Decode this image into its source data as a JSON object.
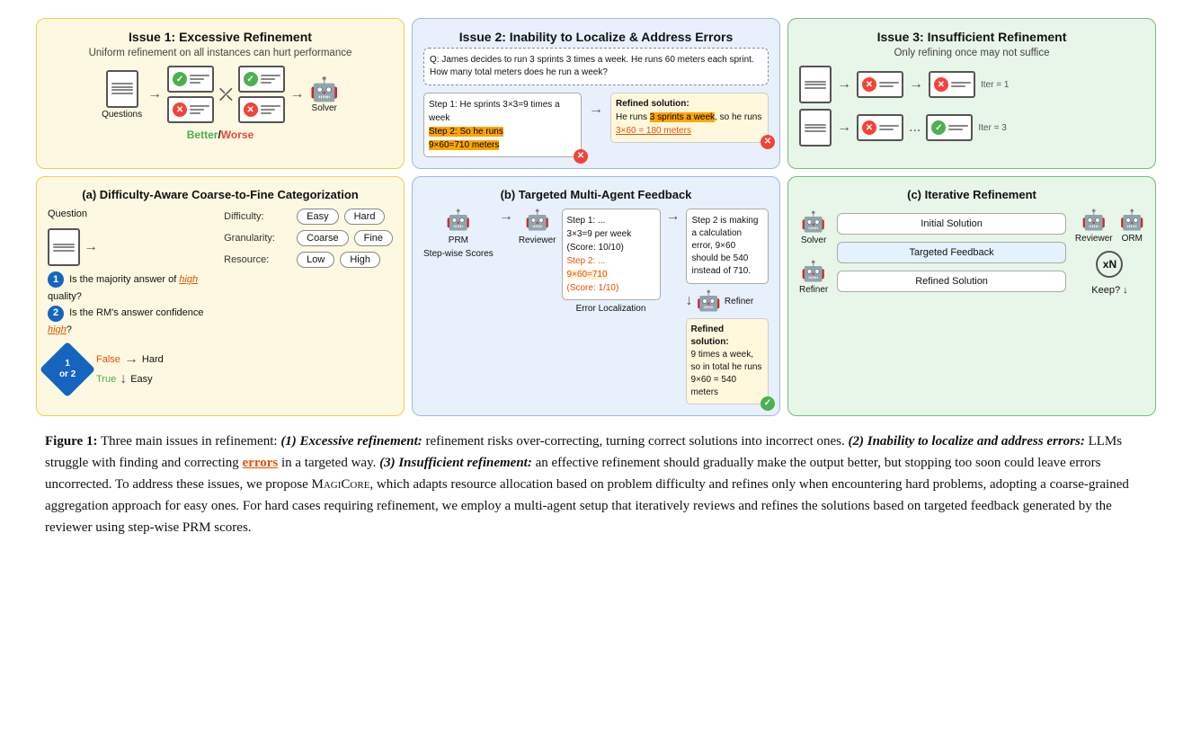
{
  "top_panels": {
    "issue1": {
      "title": "Issue 1: Excessive Refinement",
      "subtitle": "Uniform refinement on all instances can hurt performance",
      "better": "Better",
      "worse": "Worse",
      "solver_label": "Solver",
      "questions_label": "Questions"
    },
    "issue2": {
      "title": "Issue 2: Inability to Localize & Address Errors",
      "question": "Q: James decides to run 3 sprints 3 times a week. He runs 60 meters each sprint. How many total meters does he run a week?",
      "step1": "Step 1: He sprints 3×3=9 times a week",
      "step2_label": "Step 2: So he runs",
      "step2_value": "9×60=710 meters",
      "refined_title": "Refined solution:",
      "refined_text1": "He runs ",
      "refined_highlight": "3 sprints a week",
      "refined_text2": ", so he runs ",
      "refined_underline": "3×60 = 180 meters"
    },
    "issue3": {
      "title": "Issue 3: Insufficient Refinement",
      "subtitle": "Only refining once may not suffice",
      "iter1_label": "Iter = 1",
      "iter3_label": "Iter = 3"
    }
  },
  "bottom_panels": {
    "panel_a": {
      "title": "(a) Difficulty-Aware Coarse-to-Fine Categorization",
      "question_label": "Question",
      "q1": "Is the majority answer of ",
      "q1_high": "high",
      "q1_end": " quality?",
      "q2": "Is the RM's answer confidence ",
      "q2_high": "high",
      "q2_end": "?",
      "or_label": "1 or 2",
      "false_label": "False",
      "hard_label": "Hard",
      "true_label": "True",
      "easy_label": "Easy",
      "difficulty_label": "Difficulty:",
      "granularity_label": "Granularity:",
      "resource_label": "Resource:",
      "easy_btn": "Easy",
      "hard_btn": "Hard",
      "coarse_btn": "Coarse",
      "fine_btn": "Fine",
      "low_btn": "Low",
      "high_btn": "High"
    },
    "panel_b": {
      "title": "(b) Targeted Multi-Agent Feedback",
      "prm_label": "PRM",
      "reviewer_label": "Reviewer",
      "refiner_label": "Refiner",
      "stepwise_label": "Step-wise Scores",
      "error_label": "Error Localization",
      "step1_text": "Step 1: ...\n3×3=9 per week\n(Score: 10/10)",
      "step2_text": "Step 2: ...\n9×60=710\n(Score: 1/10)",
      "feedback_text": "Step 2 is making a calculation error, 9×60 should be 540 instead of 710.",
      "refined_title": "Refined solution:",
      "refined_text": "9 times a week, so in total he runs 9×60 = 540 meters"
    },
    "panel_c": {
      "title": "(c) Iterative Refinement",
      "solver_label": "Solver",
      "reviewer_label": "Reviewer",
      "orm_label": "ORM",
      "refiner_label": "Refiner",
      "keep_label": "Keep?",
      "initial_solution": "Initial Solution",
      "targeted_feedback": "Targeted Feedback",
      "refined_solution": "Refined Solution",
      "xn_label": "xN"
    }
  },
  "caption": {
    "label": "Figure 1:",
    "text1": " Three main issues in refinement: ",
    "issue1_italic": "(1) Excessive refinement:",
    "text2": " refinement risks over-correcting, turning correct solutions into incorrect ones. ",
    "issue2_italic": "(2) Inability to localize and address errors:",
    "text3": " LLMs struggle with finding and correcting ",
    "errors_word": "errors",
    "text4": " in a targeted way. ",
    "issue3_italic": "(3) Insufficient refinement:",
    "text5": " an effective refinement should gradually make the output better, but stopping too soon could leave errors uncorrected.  To address these issues, we propose ",
    "magicore": "MagiCore",
    "text6": ", which adapts resource allocation based on problem difficulty and refines only when encountering hard problems, adopting a coarse-grained aggregation approach for easy ones.  For hard cases requiring refinement, we employ a multi-agent setup that iteratively reviews and refines the solutions based on targeted feedback generated by the reviewer using step-wise PRM scores."
  }
}
